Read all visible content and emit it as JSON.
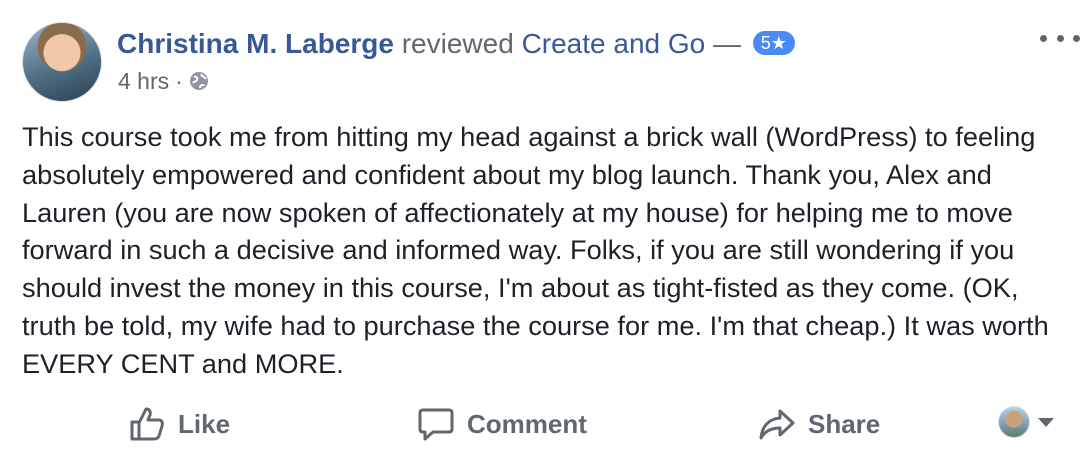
{
  "post": {
    "author": "Christina M. Laberge",
    "verb": "reviewed",
    "page": "Create and Go",
    "separator": "—",
    "rating": "5★",
    "time": "4 hrs",
    "time_separator": "·",
    "privacy_icon": "globe-icon",
    "menu_icon": "more-dots-icon",
    "review": "This course took me from hitting my head against a brick wall (WordPress) to feeling absolutely empowered and confident about my blog launch. Thank you, Alex and Lauren (you are now spoken of affectionately at my house) for helping me to move forward in such a decisive and informed way. Folks, if you are still wondering if you should invest the money in this course, I'm about as tight-fisted as they come. (OK, truth be told, my wife had to purchase the course for me. I'm that cheap.) It was worth EVERY CENT and MORE."
  },
  "actions": {
    "like": "Like",
    "comment": "Comment",
    "share": "Share",
    "like_icon": "thumbs-up-icon",
    "comment_icon": "speech-bubble-icon",
    "share_icon": "share-arrow-icon",
    "audience_icon": "chevron-down-icon"
  },
  "colors": {
    "link": "#385898",
    "secondary_text": "#616770",
    "badge": "#4a8af4",
    "body_text": "#1d2129"
  }
}
